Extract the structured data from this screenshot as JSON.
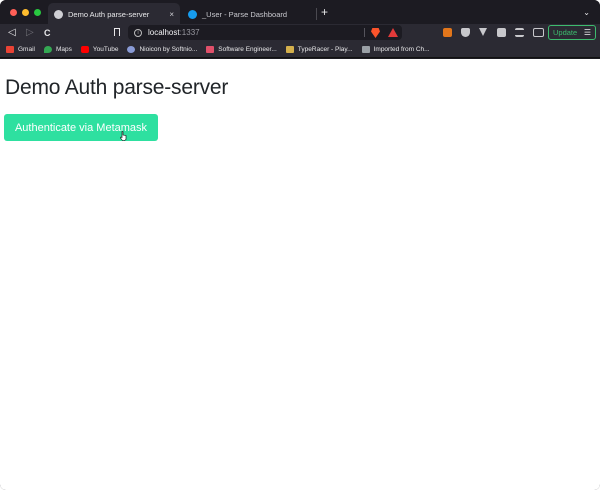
{
  "browser": {
    "tabs": [
      {
        "title": "Demo Auth parse-server",
        "active": true,
        "favicon_color": "#cfcfd4"
      },
      {
        "title": "_User - Parse Dashboard",
        "active": false,
        "favicon_color": "#169cee"
      }
    ],
    "new_tab_label": "+",
    "close_label": "×",
    "tab_list_icon": "chevron-down-icon"
  },
  "toolbar": {
    "url_host": "localhost",
    "url_port": ":1337",
    "update_label": "Update",
    "menu_glyph": "☰",
    "back_glyph": "◁",
    "forward_glyph": "▷",
    "reload_glyph": "C"
  },
  "bookmarks": [
    {
      "label": "Gmail",
      "icon": "gmail-icon",
      "color": "#ea4335"
    },
    {
      "label": "Maps",
      "icon": "maps-icon",
      "color": "#34a853"
    },
    {
      "label": "YouTube",
      "icon": "youtube-icon",
      "color": "#ff0000"
    },
    {
      "label": "Nioicon by Softnio...",
      "icon": "nioicon-icon",
      "color": "#8a9bd6"
    },
    {
      "label": "Software Engineer...",
      "icon": "software-engineer-icon",
      "color": "#e0506a"
    },
    {
      "label": "TypeRacer - Play...",
      "icon": "typeracer-icon",
      "color": "#d4b04c"
    },
    {
      "label": "Imported from Ch...",
      "icon": "folder-icon",
      "color": "#9aa0a6"
    }
  ],
  "page": {
    "title": "Demo Auth parse-server",
    "auth_button_label": "Authenticate via Metamask"
  },
  "colors": {
    "accent": "#2ee0a0",
    "update": "#3dbb6e"
  }
}
